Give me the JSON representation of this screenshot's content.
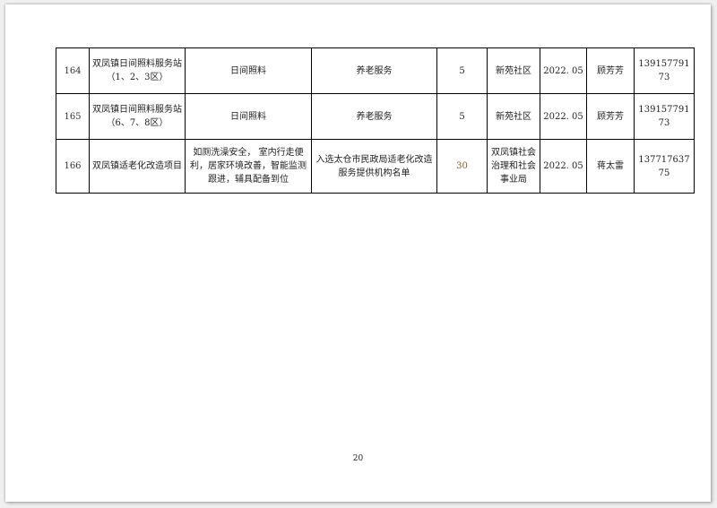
{
  "table": {
    "rows": [
      {
        "num": "164",
        "name": "双凤镇日间照料服务站（1、2、3区）",
        "content": "日间照料",
        "category": "养老服务",
        "count": "5",
        "unit": "新苑社区",
        "date": "2022. 05",
        "contact": "顾芳芳",
        "phone": "13915779173"
      },
      {
        "num": "165",
        "name": "双凤镇日间照料服务站（6、7、8区）",
        "content": "日间照料",
        "category": "养老服务",
        "count": "5",
        "unit": "新苑社区",
        "date": "2022. 05",
        "contact": "顾芳芳",
        "phone": "13915779173"
      },
      {
        "num": "166",
        "name": "双凤镇适老化改造项目",
        "content": "如厕洗澡安全， 室内行走便利，居家环境改善，智能监测跟进，辅具配备到位",
        "category": "入选太仓市民政局适老化改造服务提供机构名单",
        "count": "30",
        "unit": "双凤镇社会治理和社会事业局",
        "date": "2022. 05",
        "contact": "蒋太雷",
        "phone": "13771763775"
      }
    ]
  },
  "footer": {
    "page_number": "20"
  }
}
